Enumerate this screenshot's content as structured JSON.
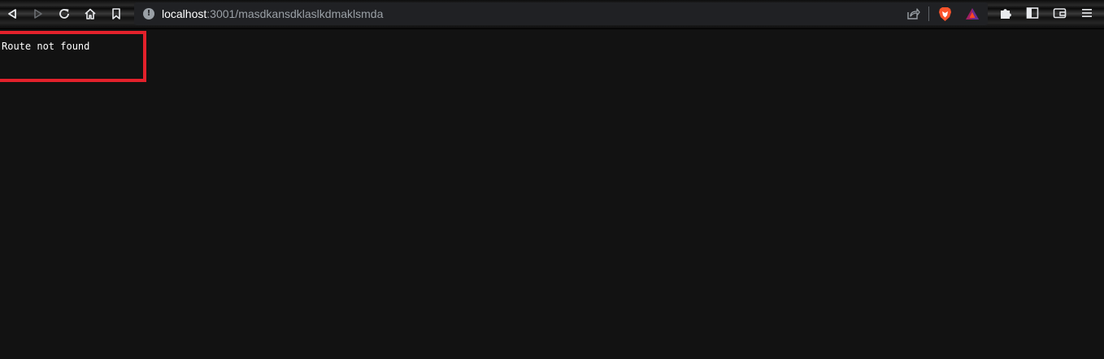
{
  "browser": {
    "url_host": "localhost",
    "url_path": ":3001/masdkansdklaslkdmaklsmda",
    "icons": {
      "back": "back-arrow-icon",
      "forward": "forward-arrow-icon",
      "reload": "reload-icon",
      "home": "home-icon",
      "bookmark": "bookmark-icon",
      "site_info": "info-icon",
      "share": "share-icon",
      "brave_shields": "brave-lion-icon",
      "brave_rewards": "bat-triangle-icon",
      "extensions": "puzzle-piece-icon",
      "sidebar": "sidebar-icon",
      "wallet": "wallet-icon",
      "menu": "hamburger-menu-icon"
    },
    "info_glyph": "!"
  },
  "page": {
    "message": "Route not found",
    "highlight_color": "#e3212b",
    "background_color": "#121212"
  }
}
